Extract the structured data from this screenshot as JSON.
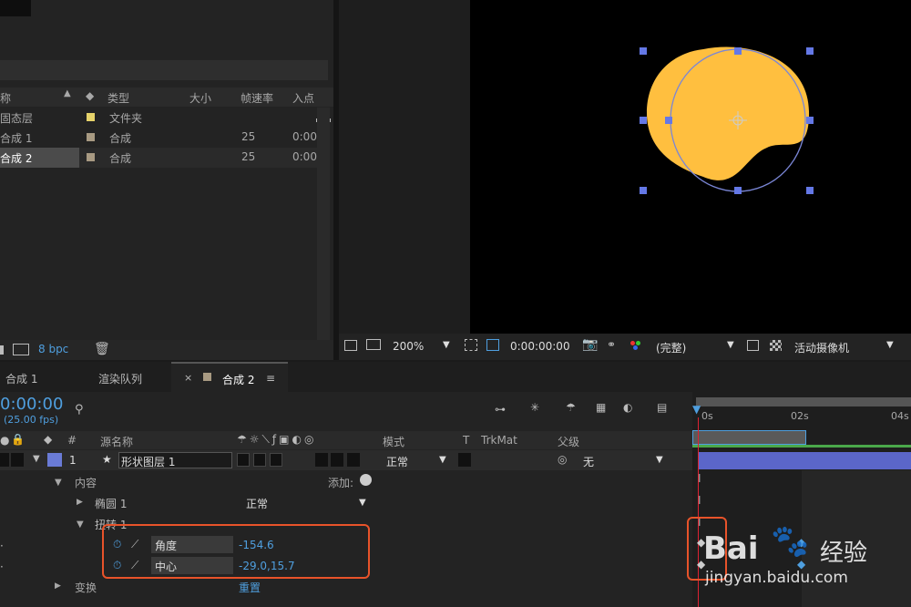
{
  "project": {
    "columns": {
      "name_header": "称",
      "type": "类型",
      "size": "大小",
      "fps": "帧速率",
      "in": "入点"
    },
    "items": [
      {
        "name": "固态层",
        "type": "文件夹",
        "fps": "",
        "in": "",
        "color": "#e6d36a"
      },
      {
        "name": "合成 1",
        "type": "合成",
        "fps": "25",
        "in": "0:00",
        "color": "#a89a82"
      },
      {
        "name": "合成 2",
        "type": "合成",
        "fps": "25",
        "in": "0:00",
        "color": "#a89a82"
      }
    ],
    "bpc": "8 bpc"
  },
  "viewer": {
    "zoom": "200%",
    "timecode": "0:00:00:00",
    "quality": "(完整)",
    "camera": "活动摄像机",
    "shape_color": "#ffbf3f"
  },
  "tabs": [
    {
      "label": "合成 1"
    },
    {
      "label": "渲染队列"
    },
    {
      "label": "合成 2",
      "active": true
    }
  ],
  "timeline": {
    "timecode": "0:00:00",
    "fps": "(25.00 fps)",
    "search_placeholder": "",
    "columns": {
      "hash": "#",
      "source_name": "源名称",
      "mode": "模式",
      "t": "T",
      "trkmat": "TrkMat",
      "parent": "父级"
    },
    "ruler": [
      "0s",
      "02s",
      "04s"
    ],
    "layer": {
      "num": "1",
      "name": "形状图层 1",
      "mode": "正常",
      "parent": "无"
    },
    "tree": {
      "contents": "内容",
      "add": "添加:",
      "ellipse": "椭圆 1",
      "ellipse_mode": "正常",
      "twist": "扭转 1",
      "angle_label": "角度",
      "angle_value": "-154.6",
      "center_label": "中心",
      "center_value": "-29.0,15.7",
      "transform": "变换",
      "reset": "重置"
    }
  },
  "watermark": {
    "brand": "Bai",
    "brand2": "经验",
    "url": "jingyan.baidu.com"
  }
}
